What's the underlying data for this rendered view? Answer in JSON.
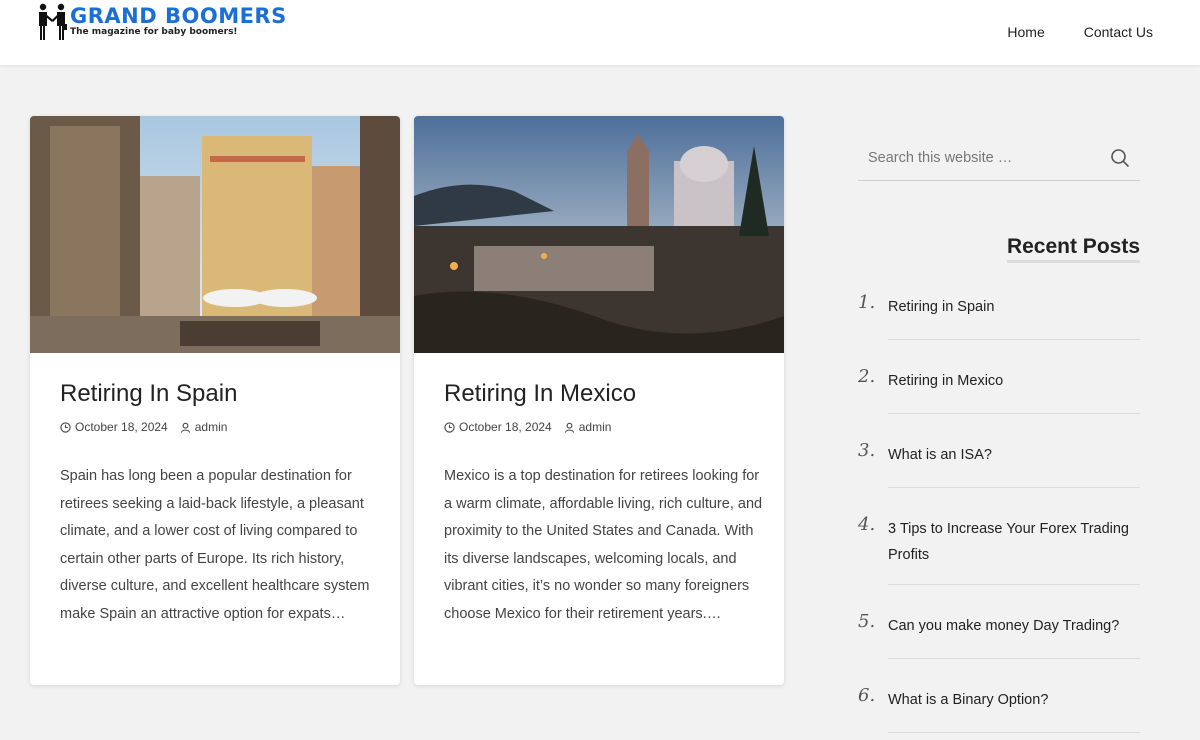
{
  "site": {
    "title": "GRAND BOOMERS",
    "tagline": "The magazine for baby boomers!"
  },
  "nav": {
    "items": [
      "Home",
      "Contact Us"
    ]
  },
  "posts": [
    {
      "title": "Retiring In Spain",
      "date": "October 18, 2024",
      "author": "admin",
      "excerpt": "Spain has long been a popular destination for retirees seeking a laid-back lifestyle, a pleasant climate, and a lower cost of living compared to certain other parts of Europe. Its rich history, diverse culture, and excellent healthcare system make Spain an attractive option for expats…"
    },
    {
      "title": "Retiring In Mexico",
      "date": "October 18, 2024",
      "author": "admin",
      "excerpt": "Mexico is a top destination for retirees looking for a warm climate, affordable living, rich culture, and proximity to the United States and Canada. With its diverse landscapes, welcoming locals, and vibrant cities, it’s no wonder so many foreigners choose Mexico for their retirement years.…"
    }
  ],
  "sidebar": {
    "search_placeholder": "Search this website …",
    "recent_title": "Recent Posts",
    "recent": [
      {
        "num": "1.",
        "label": "Retiring in Spain"
      },
      {
        "num": "2.",
        "label": "Retiring in Mexico"
      },
      {
        "num": "3.",
        "label": "What is an ISA?"
      },
      {
        "num": "4.",
        "label": "3 Tips to Increase Your Forex Trading Profits"
      },
      {
        "num": "5.",
        "label": "Can you make money Day Trading?"
      },
      {
        "num": "6.",
        "label": "What is a Binary Option?"
      }
    ]
  },
  "colors": {
    "brand": "#1a6fd6",
    "background": "#f2f2f2"
  }
}
